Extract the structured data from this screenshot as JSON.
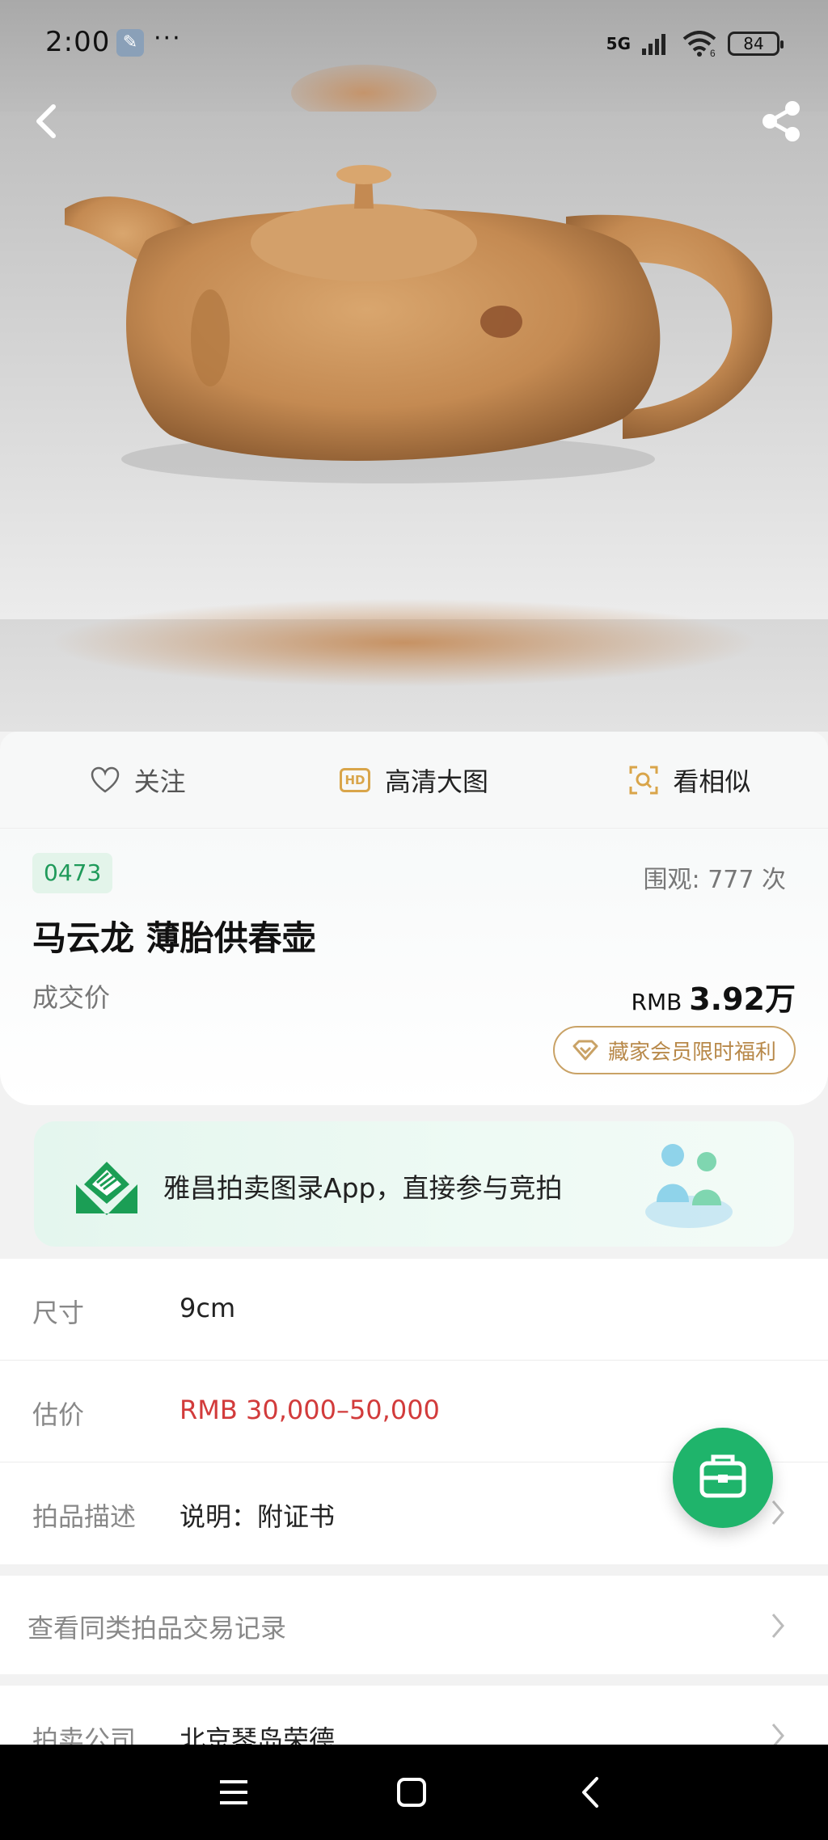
{
  "status_bar": {
    "time": "2:00",
    "dots": "···",
    "network": "5G",
    "wifi_sub": "6",
    "battery": "84"
  },
  "action_bar": {
    "follow": "关注",
    "hd": "高清大图",
    "hd_badge": "HD",
    "similar": "看相似"
  },
  "lot": {
    "number": "0473",
    "views": "围观:  777  次",
    "title": "马云龙 薄胎供春壶",
    "deal_label": "成交价",
    "currency": "RMB",
    "deal_price": "3.92万",
    "vip_text": "藏家会员限时福利"
  },
  "banner": {
    "text": "雅昌拍卖图录App，直接参与竞拍"
  },
  "details": [
    {
      "label": "尺寸",
      "value": "9cm"
    },
    {
      "label": "估价",
      "value": "RMB  30,000–50,000"
    },
    {
      "label": "拍品描述",
      "value": "说明：附证书"
    }
  ],
  "links": {
    "similar_records": "查看同类拍品交易记录"
  },
  "company": {
    "label": "拍卖公司",
    "value": "北京琴岛荣德"
  },
  "colors": {
    "accent_green": "#1fb46b",
    "price_red": "#d23b3b",
    "gold": "#c9a266"
  }
}
